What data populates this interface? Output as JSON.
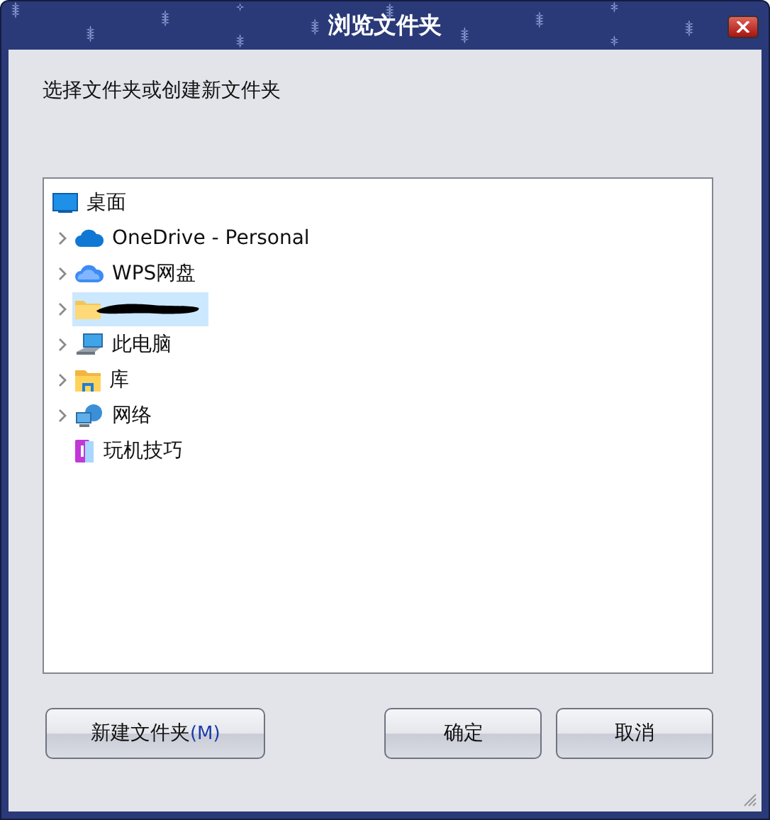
{
  "window": {
    "title": "浏览文件夹"
  },
  "prompt": "选择文件夹或创建新文件夹",
  "tree": [
    {
      "label": "桌面",
      "kind": "desktop",
      "expanded": true,
      "selected": false,
      "children": [
        {
          "label": "OneDrive - Personal",
          "kind": "cloud",
          "expandable": true,
          "selected": false
        },
        {
          "label": "WPS网盘",
          "kind": "cloud2",
          "expandable": true,
          "selected": false
        },
        {
          "kind": "folder",
          "redacted": true,
          "expandable": true,
          "selected": true
        },
        {
          "label": "此电脑",
          "kind": "computer",
          "expandable": true,
          "selected": false
        },
        {
          "label": "库",
          "kind": "library",
          "expandable": true,
          "selected": false
        },
        {
          "label": "网络",
          "kind": "network",
          "expandable": true,
          "selected": false
        },
        {
          "label": "玩机技巧",
          "kind": "app",
          "expandable": false,
          "selected": false
        }
      ]
    }
  ],
  "buttons": [
    {
      "label": "新建文件夹",
      "accel": "(M)",
      "kind": "left"
    },
    {
      "label": "确定",
      "kind": "right"
    },
    {
      "label": "取消",
      "kind": "right"
    }
  ]
}
